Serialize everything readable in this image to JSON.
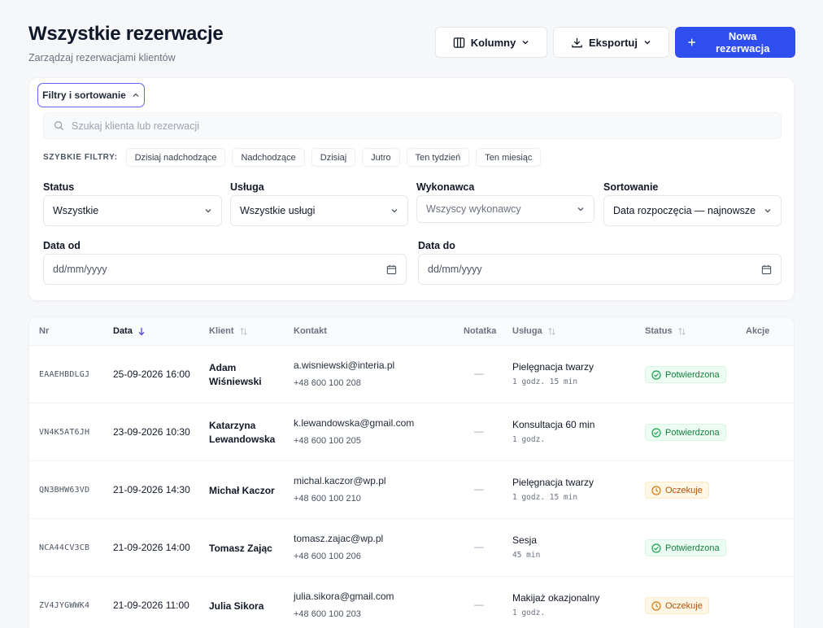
{
  "header": {
    "title": "Wszystkie rezerwacje",
    "subtitle": "Zarządzaj rezerwacjami klientów"
  },
  "toolbar": {
    "columns_label": "Kolumny",
    "export_label": "Eksportuj",
    "new_label": "Nowa rezerwacja"
  },
  "filters": {
    "toggle_label": "Filtry i sortowanie",
    "search_placeholder": "Szukaj klienta lub rezerwacji",
    "quick_label": "SZYBKIE FILTRY:",
    "quick": [
      "Dzisiaj nadchodzące",
      "Nadchodzące",
      "Dzisiaj",
      "Jutro",
      "Ten tydzień",
      "Ten miesiąc"
    ],
    "status": {
      "label": "Status",
      "value": "Wszystkie"
    },
    "service": {
      "label": "Usługa",
      "value": "Wszystkie usługi"
    },
    "performer": {
      "label": "Wykonawca",
      "value": "Wszyscy wykonawcy"
    },
    "sort": {
      "label": "Sortowanie",
      "value": "Data rozpoczęcia — najnowsze"
    },
    "date_from": {
      "label": "Data od",
      "placeholder": "dd/mm/yyyy"
    },
    "date_to": {
      "label": "Data do",
      "placeholder": "dd/mm/yyyy"
    }
  },
  "table": {
    "columns": {
      "nr": "Nr",
      "date": "Data",
      "client": "Klient",
      "contact": "Kontakt",
      "note": "Notatka",
      "service": "Usługa",
      "status": "Status",
      "actions": "Akcje"
    },
    "rows": [
      {
        "nr": "EAAEHBDLGJ",
        "date": "25-09-2026 16:00",
        "client": "Adam Wiśniewski",
        "email": "a.wisniewski@interia.pl",
        "phone": "+48 600 100 208",
        "note": "—",
        "service": "Pielęgnacja twarzy",
        "duration": "1 godz. 15 min",
        "status": "Potwierdzona",
        "status_type": "confirmed"
      },
      {
        "nr": "VN4K5AT6JH",
        "date": "23-09-2026 10:30",
        "client": "Katarzyna Lewandowska",
        "email": "k.lewandowska@gmail.com",
        "phone": "+48 600 100 205",
        "note": "—",
        "service": "Konsultacja 60 min",
        "duration": "1 godz.",
        "status": "Potwierdzona",
        "status_type": "confirmed"
      },
      {
        "nr": "QN3BHW63VD",
        "date": "21-09-2026 14:30",
        "client": "Michał Kaczor",
        "email": "michal.kaczor@wp.pl",
        "phone": "+48 600 100 210",
        "note": "—",
        "service": "Pielęgnacja twarzy",
        "duration": "1 godz. 15 min",
        "status": "Oczekuje",
        "status_type": "pending"
      },
      {
        "nr": "NCA44CV3CB",
        "date": "21-09-2026 14:00",
        "client": "Tomasz Zając",
        "email": "tomasz.zajac@wp.pl",
        "phone": "+48 600 100 206",
        "note": "—",
        "service": "Sesja",
        "duration": "45 min",
        "status": "Potwierdzona",
        "status_type": "confirmed"
      },
      {
        "nr": "ZV4JYGWWK4",
        "date": "21-09-2026 11:00",
        "client": "Julia Sikora",
        "email": "julia.sikora@gmail.com",
        "phone": "+48 600 100 203",
        "note": "—",
        "service": "Makijaż okazjonalny",
        "duration": "1 godz.",
        "status": "Oczekuje",
        "status_type": "pending"
      }
    ]
  },
  "colors": {
    "accent": "#2f4ef0",
    "confirmed": "#15803d",
    "pending": "#b45309"
  }
}
